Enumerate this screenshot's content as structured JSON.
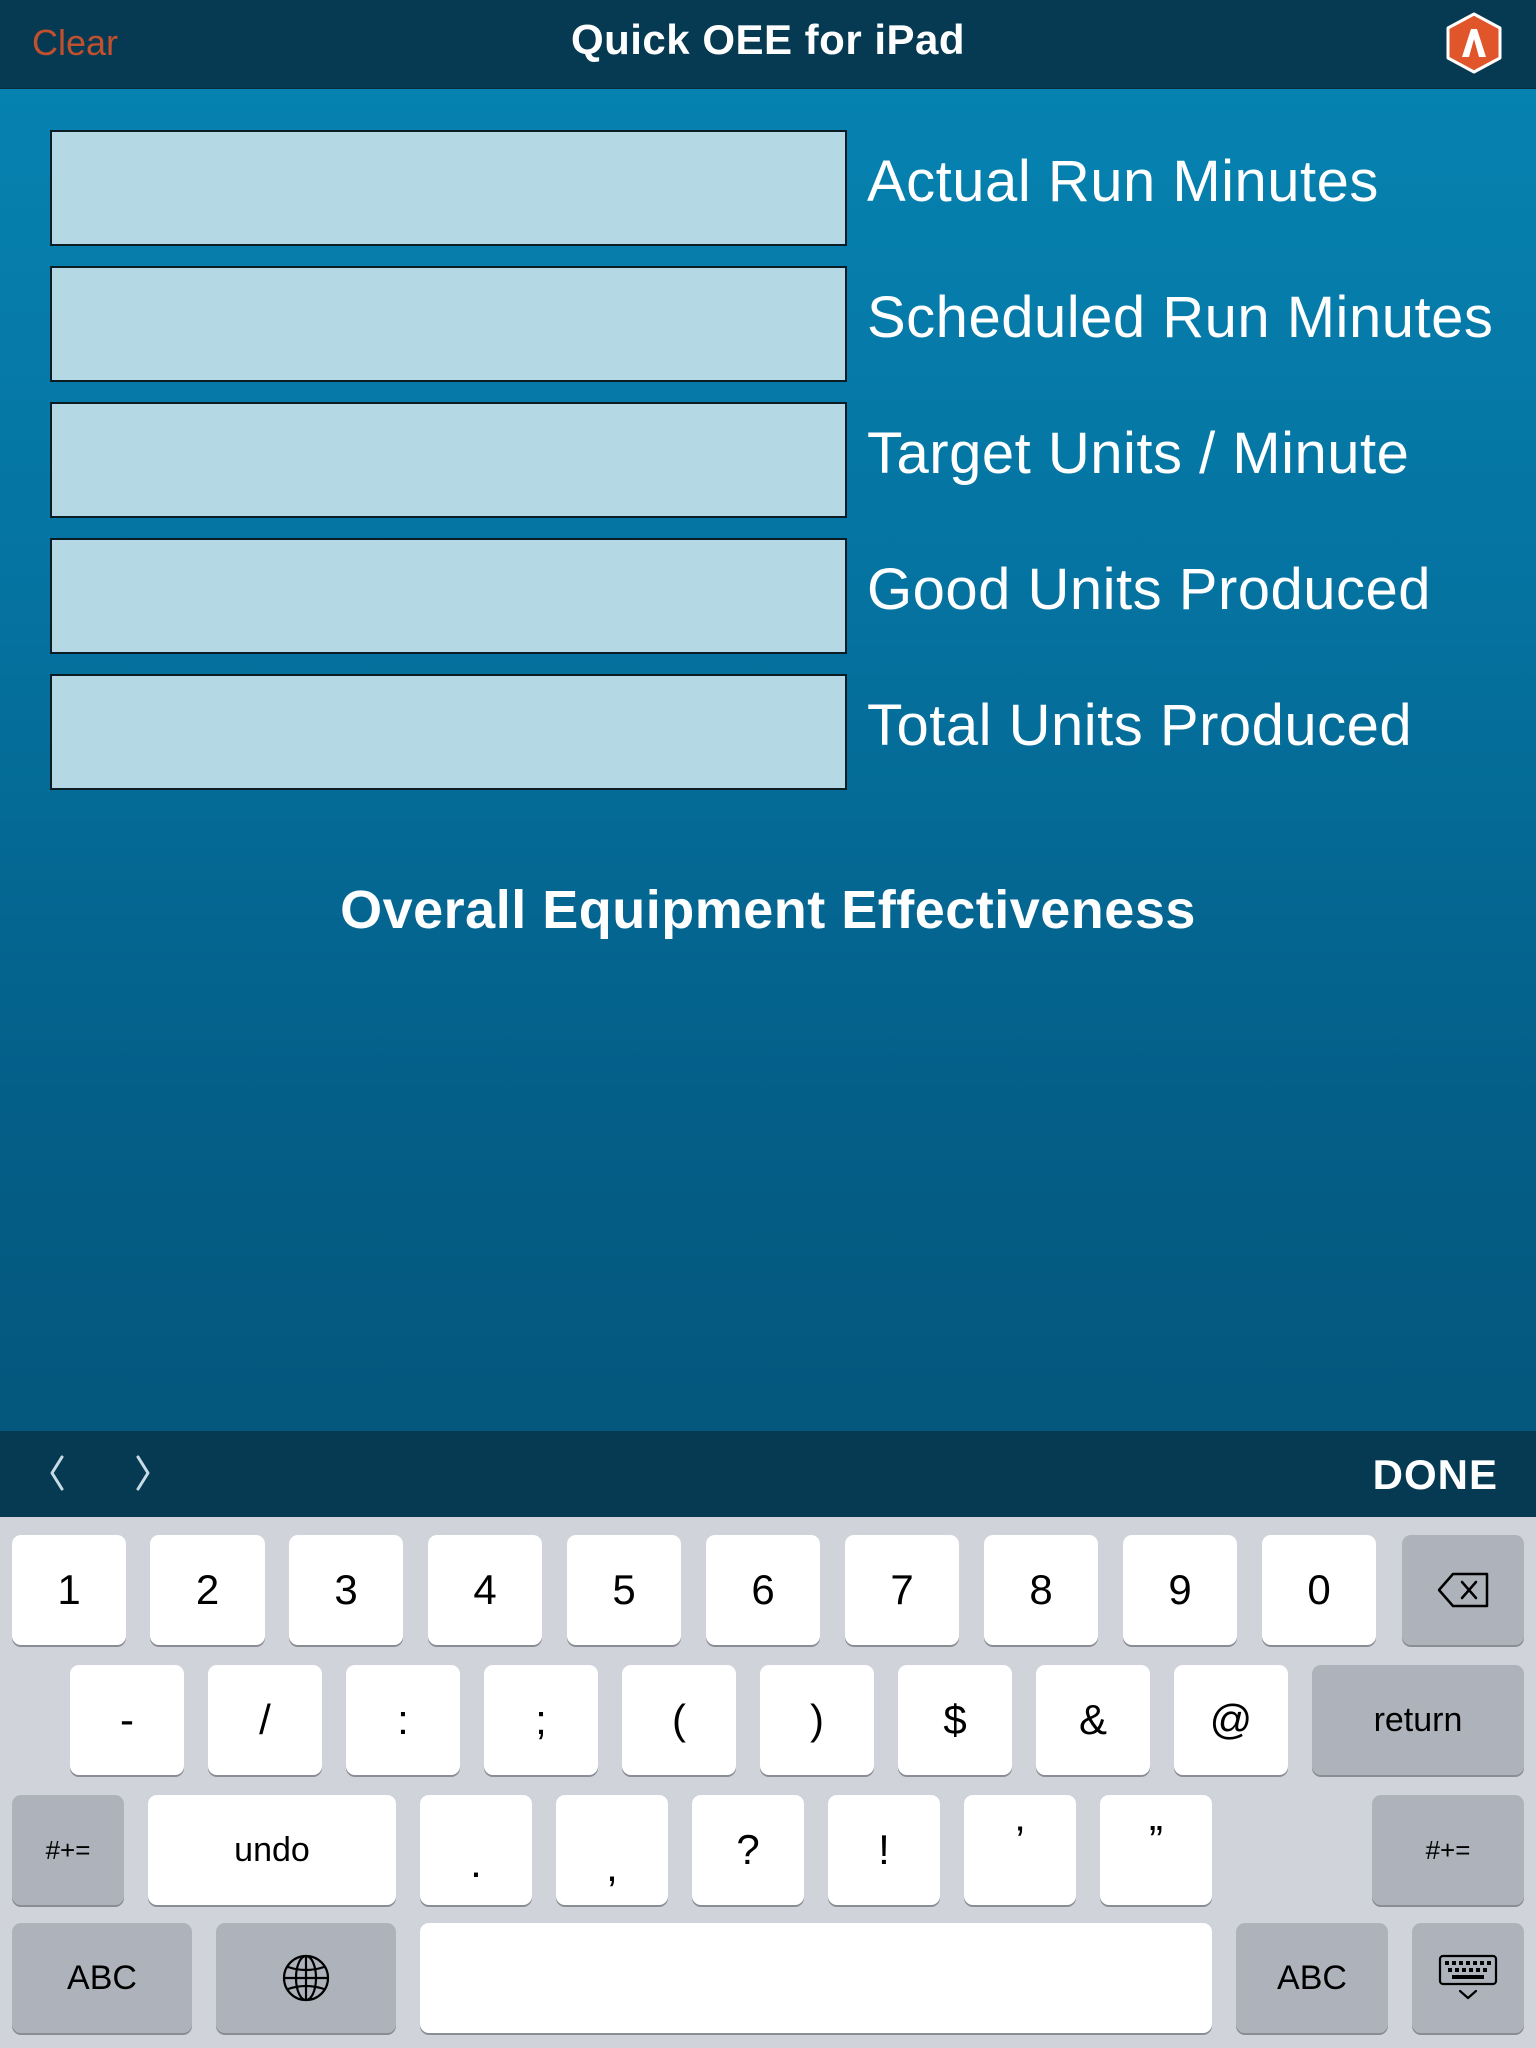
{
  "navbar": {
    "clear_label": "Clear",
    "title": "Quick OEE for iPad",
    "logo_icon": "app-logo-icon",
    "clear_color": "#c0502e"
  },
  "fields": [
    {
      "label": "Actual Run Minutes",
      "value": ""
    },
    {
      "label": "Scheduled Run Minutes",
      "value": ""
    },
    {
      "label": "Target Units / Minute",
      "value": ""
    },
    {
      "label": "Good Units Produced",
      "value": ""
    },
    {
      "label": "Total Units Produced",
      "value": ""
    }
  ],
  "result": {
    "title": "Overall Equipment Effectiveness"
  },
  "accessory": {
    "prev_icon": "chevron-left-icon",
    "next_icon": "chevron-right-icon",
    "done_label": "DONE"
  },
  "keyboard": {
    "row1": [
      "1",
      "2",
      "3",
      "4",
      "5",
      "6",
      "7",
      "8",
      "9",
      "0"
    ],
    "delete_icon": "backspace-icon",
    "row2": [
      "-",
      "/",
      ":",
      ";",
      "(",
      ")",
      "$",
      "&",
      "@"
    ],
    "return_label": "return",
    "shift_label": "#+=",
    "undo_label": "undo",
    "row3": [
      ".",
      ",",
      "?",
      "!",
      "’",
      "”"
    ],
    "abc_label": "ABC",
    "globe_icon": "globe-icon",
    "space_label": "",
    "dismiss_icon": "keyboard-dismiss-icon"
  }
}
